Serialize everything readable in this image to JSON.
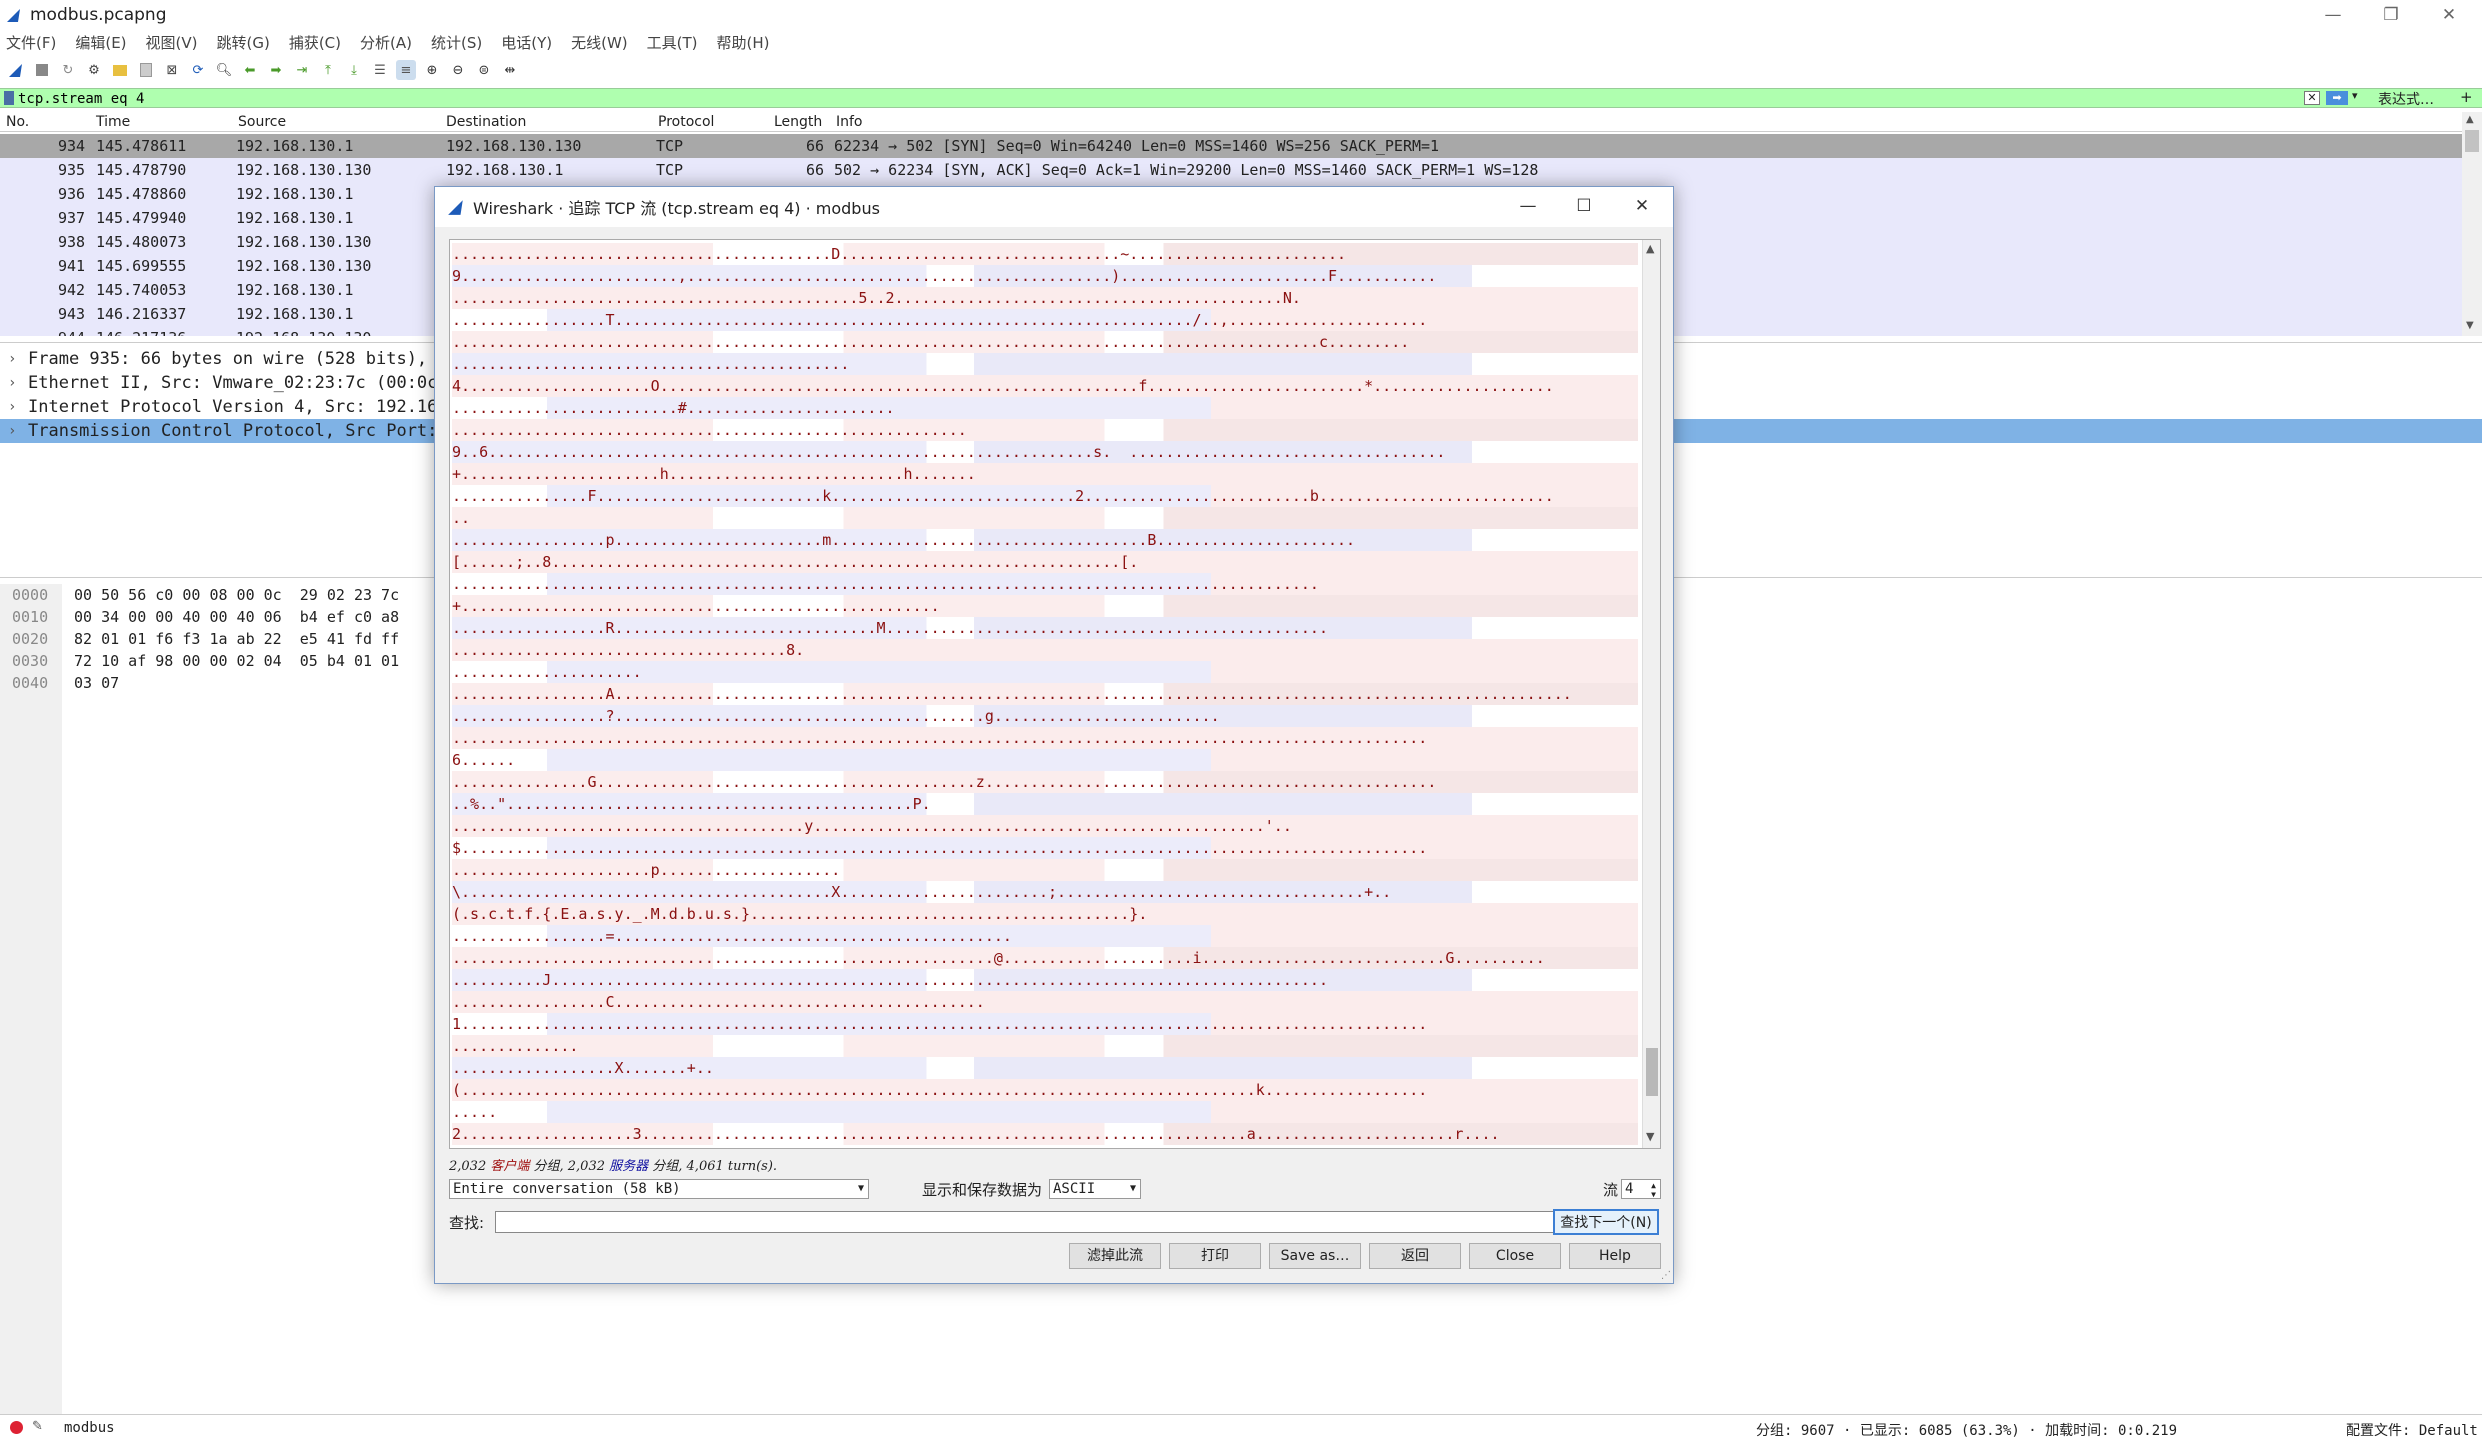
{
  "window": {
    "title": "modbus.pcapng",
    "controls": [
      "—",
      "❐",
      "✕"
    ]
  },
  "menu": [
    "文件(F)",
    "编辑(E)",
    "视图(V)",
    "跳转(G)",
    "捕获(C)",
    "分析(A)",
    "统计(S)",
    "电话(Y)",
    "无线(W)",
    "工具(T)",
    "帮助(H)"
  ],
  "filter": {
    "value": "tcp.stream eq 4",
    "expression_label": "表达式…",
    "plus": "+"
  },
  "packet_list": {
    "headers": [
      "No.",
      "Time",
      "Source",
      "Destination",
      "Protocol",
      "Length",
      "Info"
    ],
    "rows": [
      {
        "no": "934",
        "time": "145.478611",
        "src": "192.168.130.1",
        "dst": "192.168.130.130",
        "proto": "TCP",
        "len": "66",
        "info": "62234 → 502 [SYN] Seq=0 Win=64240 Len=0 MSS=1460 WS=256 SACK_PERM=1"
      },
      {
        "no": "935",
        "time": "145.478790",
        "src": "192.168.130.130",
        "dst": "192.168.130.1",
        "proto": "TCP",
        "len": "66",
        "info": "502 → 62234 [SYN, ACK] Seq=0 Ack=1 Win=29200 Len=0 MSS=1460 SACK_PERM=1 WS=128"
      },
      {
        "no": "936",
        "time": "145.478860",
        "src": "192.168.130.1",
        "dst": "",
        "proto": "",
        "len": "",
        "info": ""
      },
      {
        "no": "937",
        "time": "145.479940",
        "src": "192.168.130.1",
        "dst": "",
        "proto": "",
        "len": "",
        "info": ""
      },
      {
        "no": "938",
        "time": "145.480073",
        "src": "192.168.130.130",
        "dst": "",
        "proto": "",
        "len": "",
        "info": ""
      },
      {
        "no": "941",
        "time": "145.699555",
        "src": "192.168.130.130",
        "dst": "",
        "proto": "",
        "len": "",
        "info": ""
      },
      {
        "no": "942",
        "time": "145.740053",
        "src": "192.168.130.1",
        "dst": "",
        "proto": "",
        "len": "",
        "info": ""
      },
      {
        "no": "943",
        "time": "146.216337",
        "src": "192.168.130.1",
        "dst": "",
        "proto": "",
        "len": "",
        "info": ""
      },
      {
        "no": "944",
        "time": "146.217136",
        "src": "192.168.130.130",
        "dst": "",
        "proto": "",
        "len": "",
        "info": ""
      }
    ]
  },
  "details": [
    {
      "arrow": "›",
      "text": "Frame 935: 66 bytes on wire (528 bits), 6"
    },
    {
      "arrow": "›",
      "text": "Ethernet II, Src: Vmware_02:23:7c (00:0c:"
    },
    {
      "arrow": "›",
      "text": "Internet Protocol Version 4, Src: 192.168"
    },
    {
      "arrow": "›",
      "text": "Transmission Control Protocol, Src Port:"
    }
  ],
  "bytes": [
    {
      "off": "0000",
      "hex": "00 50 56 c0 00 08 00 0c  29 02 23 7c"
    },
    {
      "off": "0010",
      "hex": "00 34 00 00 40 00 40 06  b4 ef c0 a8"
    },
    {
      "off": "0020",
      "hex": "82 01 01 f6 f3 1a ab 22  e5 41 fd ff"
    },
    {
      "off": "0030",
      "hex": "72 10 af 98 00 00 02 04  05 b4 01 01"
    },
    {
      "off": "0040",
      "hex": "03 07"
    }
  ],
  "dialog": {
    "title": "Wireshark · 追踪 TCP 流 (tcp.stream eq 4) · modbus",
    "stream_lines": [
      "..........................................D...............................~........................",
      "9........................,...............................................).......................F...........",
      ".............................................5..2...........................................N.",
      ".................T................................................................/..,......................",
      "................................................................................................c.........",
      "............................................",
      "4.....................O.....................................................f........................*....................",
      ".........................#.......................",
      ".........................................................",
      "9..6...................................................................s.  ...................................",
      "+......................h..........................h.......",
      "...............F.........................k...........................2.........................b..........................",
      "..",
      ".................p.......................m...................................B......................",
      "[......;..8...............................................................[.",
      "................................................................................................",
      "+.....................................................",
      ".................R.............................M.................................................",
      ".....................................8.",
      ".....................",
      ".................A..........................................................................................................",
      ".................?.........................................g.........................",
      "............................................................................................................",
      "6......",
      "...............G..........................................z..................................................",
      "..%..\".............................................P.",
      ".......................................y..................................................'..",
      "$...........................................................................................................",
      "......................p....................",
      "\\.........................................X.......................;..................................+..",
      "(.s.c.t.f.{.E.a.s.y._.M.d.b.u.s.}..........................................}.",
      ".................=............................................",
      "............................................................@.....................i...........................G..........",
      "..........J......................................................................................",
      ".................C.........................................",
      "1...........................................................................................................",
      "..............",
      "..................X.......+..",
      "(........................................................................................k..................",
      ".....",
      "2...................3...................................................................a......................r...."
    ],
    "summary": {
      "client": "2,032 客户端 分组,",
      "c_pre": "2,032",
      "c_mid": "客户端",
      "server_pre": " 分组, 2,032 ",
      "server": "服务器",
      "rest": " 分组, 4,061 turn(s)."
    },
    "conversation_select": "Entire conversation (58 kB)",
    "show_as_label": "显示和保存数据为",
    "show_as_value": "ASCII",
    "stream_label": "流",
    "stream_value": "4",
    "find_label": "查找:",
    "find_value": "",
    "find_next": "查找下一个(N)",
    "buttons": [
      "滤掉此流",
      "打印",
      "Save as…",
      "返回",
      "Close",
      "Help"
    ]
  },
  "statusbar": {
    "profile_name": "modbus",
    "packets": "分组: 9607 · 已显示: 6085 (63.3%) · 加载时间: 0:0.219",
    "config": "配置文件: Default"
  },
  "colors": {
    "filter_ok": "#afffaf",
    "selected_row": "#a8a8a8",
    "highlight_blue": "#7fb2e5",
    "client_text": "#8a1010",
    "row_lavender": "#e8e8fb"
  }
}
